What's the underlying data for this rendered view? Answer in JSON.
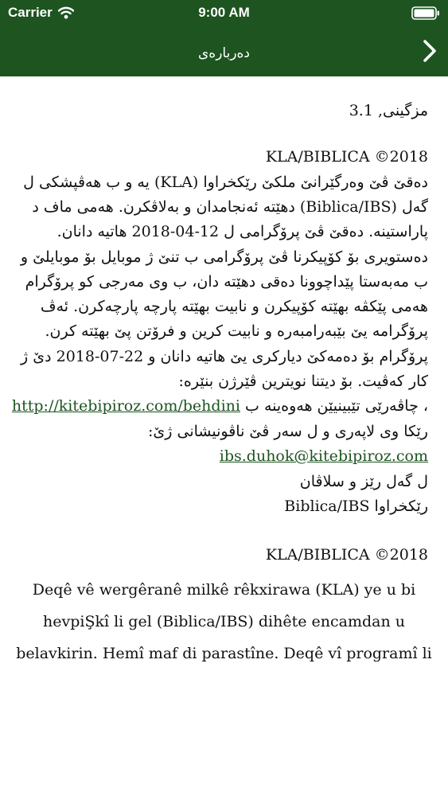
{
  "status_bar": {
    "carrier": "Carrier",
    "time": "9:00 AM"
  },
  "nav": {
    "title": "دەربارەی",
    "back_icon": "chevron-right-icon"
  },
  "content": {
    "version_line": "مزگینی, 3.1",
    "copyright_1": "KLA/BIBLICA ©2018",
    "p1": [
      "دەقێ ڤێ وەرگێرانێ ملکێ رێکخراوا (KLA) یە و ب هەڤپشکی ل",
      "گەل (Biblica/IBS) دهێتە ئەنجامدان و بەلاڤکرن. هەمی ماف د",
      "پاراستینە. دەقێ ڤێ پرۆگرامی ل 12-04-2018 هاتیە دانان."
    ],
    "p2": [
      "دەستویری بۆ کۆپیکرنا ڤێ پرۆگرامی ب تنێ ژ موبایل بۆ موبایلێ و",
      "ب مەبەستا پێداچوونا دەقی دهێتە دان، ب وی مەرجی کو پرۆگرام",
      "هەمی پێکڤە بهێتە کۆپیکرن و نابیت بهێتە پارچە پارچەکرن. ئەڤ",
      "پرۆگرامە یێ بێبەرامبەرە و نابیت کرین و فرۆتن پێ بهێتە کرن."
    ],
    "p3": [
      "پرۆگرام بۆ دەمەکێ دیارکری یێ هاتیە دانان و 22-07-2018 دێ ژ",
      "کار کەڤیت. بۆ دیتنا نویترین ڤێرژن بنێرە:"
    ],
    "link_line_text": "، چاڤەرێی تێبینیێن هەوەینە ب",
    "website_link": "http://kitebipiroz.com/behdini",
    "p4": "رێکا وی لاپەری و ل سەر ڤێ ناڤونیشانی ژێ:",
    "email_link": "ibs.duhok@kitebipiroz.com",
    "regards": "ل گەل رێز و سلاڤان",
    "org_signature": "رێکخراوا Biblica/IBS",
    "copyright_2": "KLA/BIBLICA ©2018",
    "latin_lines": [
      "Deqê vê wergêranê milkê rêkxirawa (KLA) ye u bi",
      "hevpiŞkî li gel (Biblica/IBS) dihête encamdan u",
      "belavkirin. Hemî maf di parastîne. Deqê vî programî li"
    ]
  },
  "colors": {
    "header_bg": "#1d5420",
    "link": "#1d5420",
    "text": "#111111"
  }
}
